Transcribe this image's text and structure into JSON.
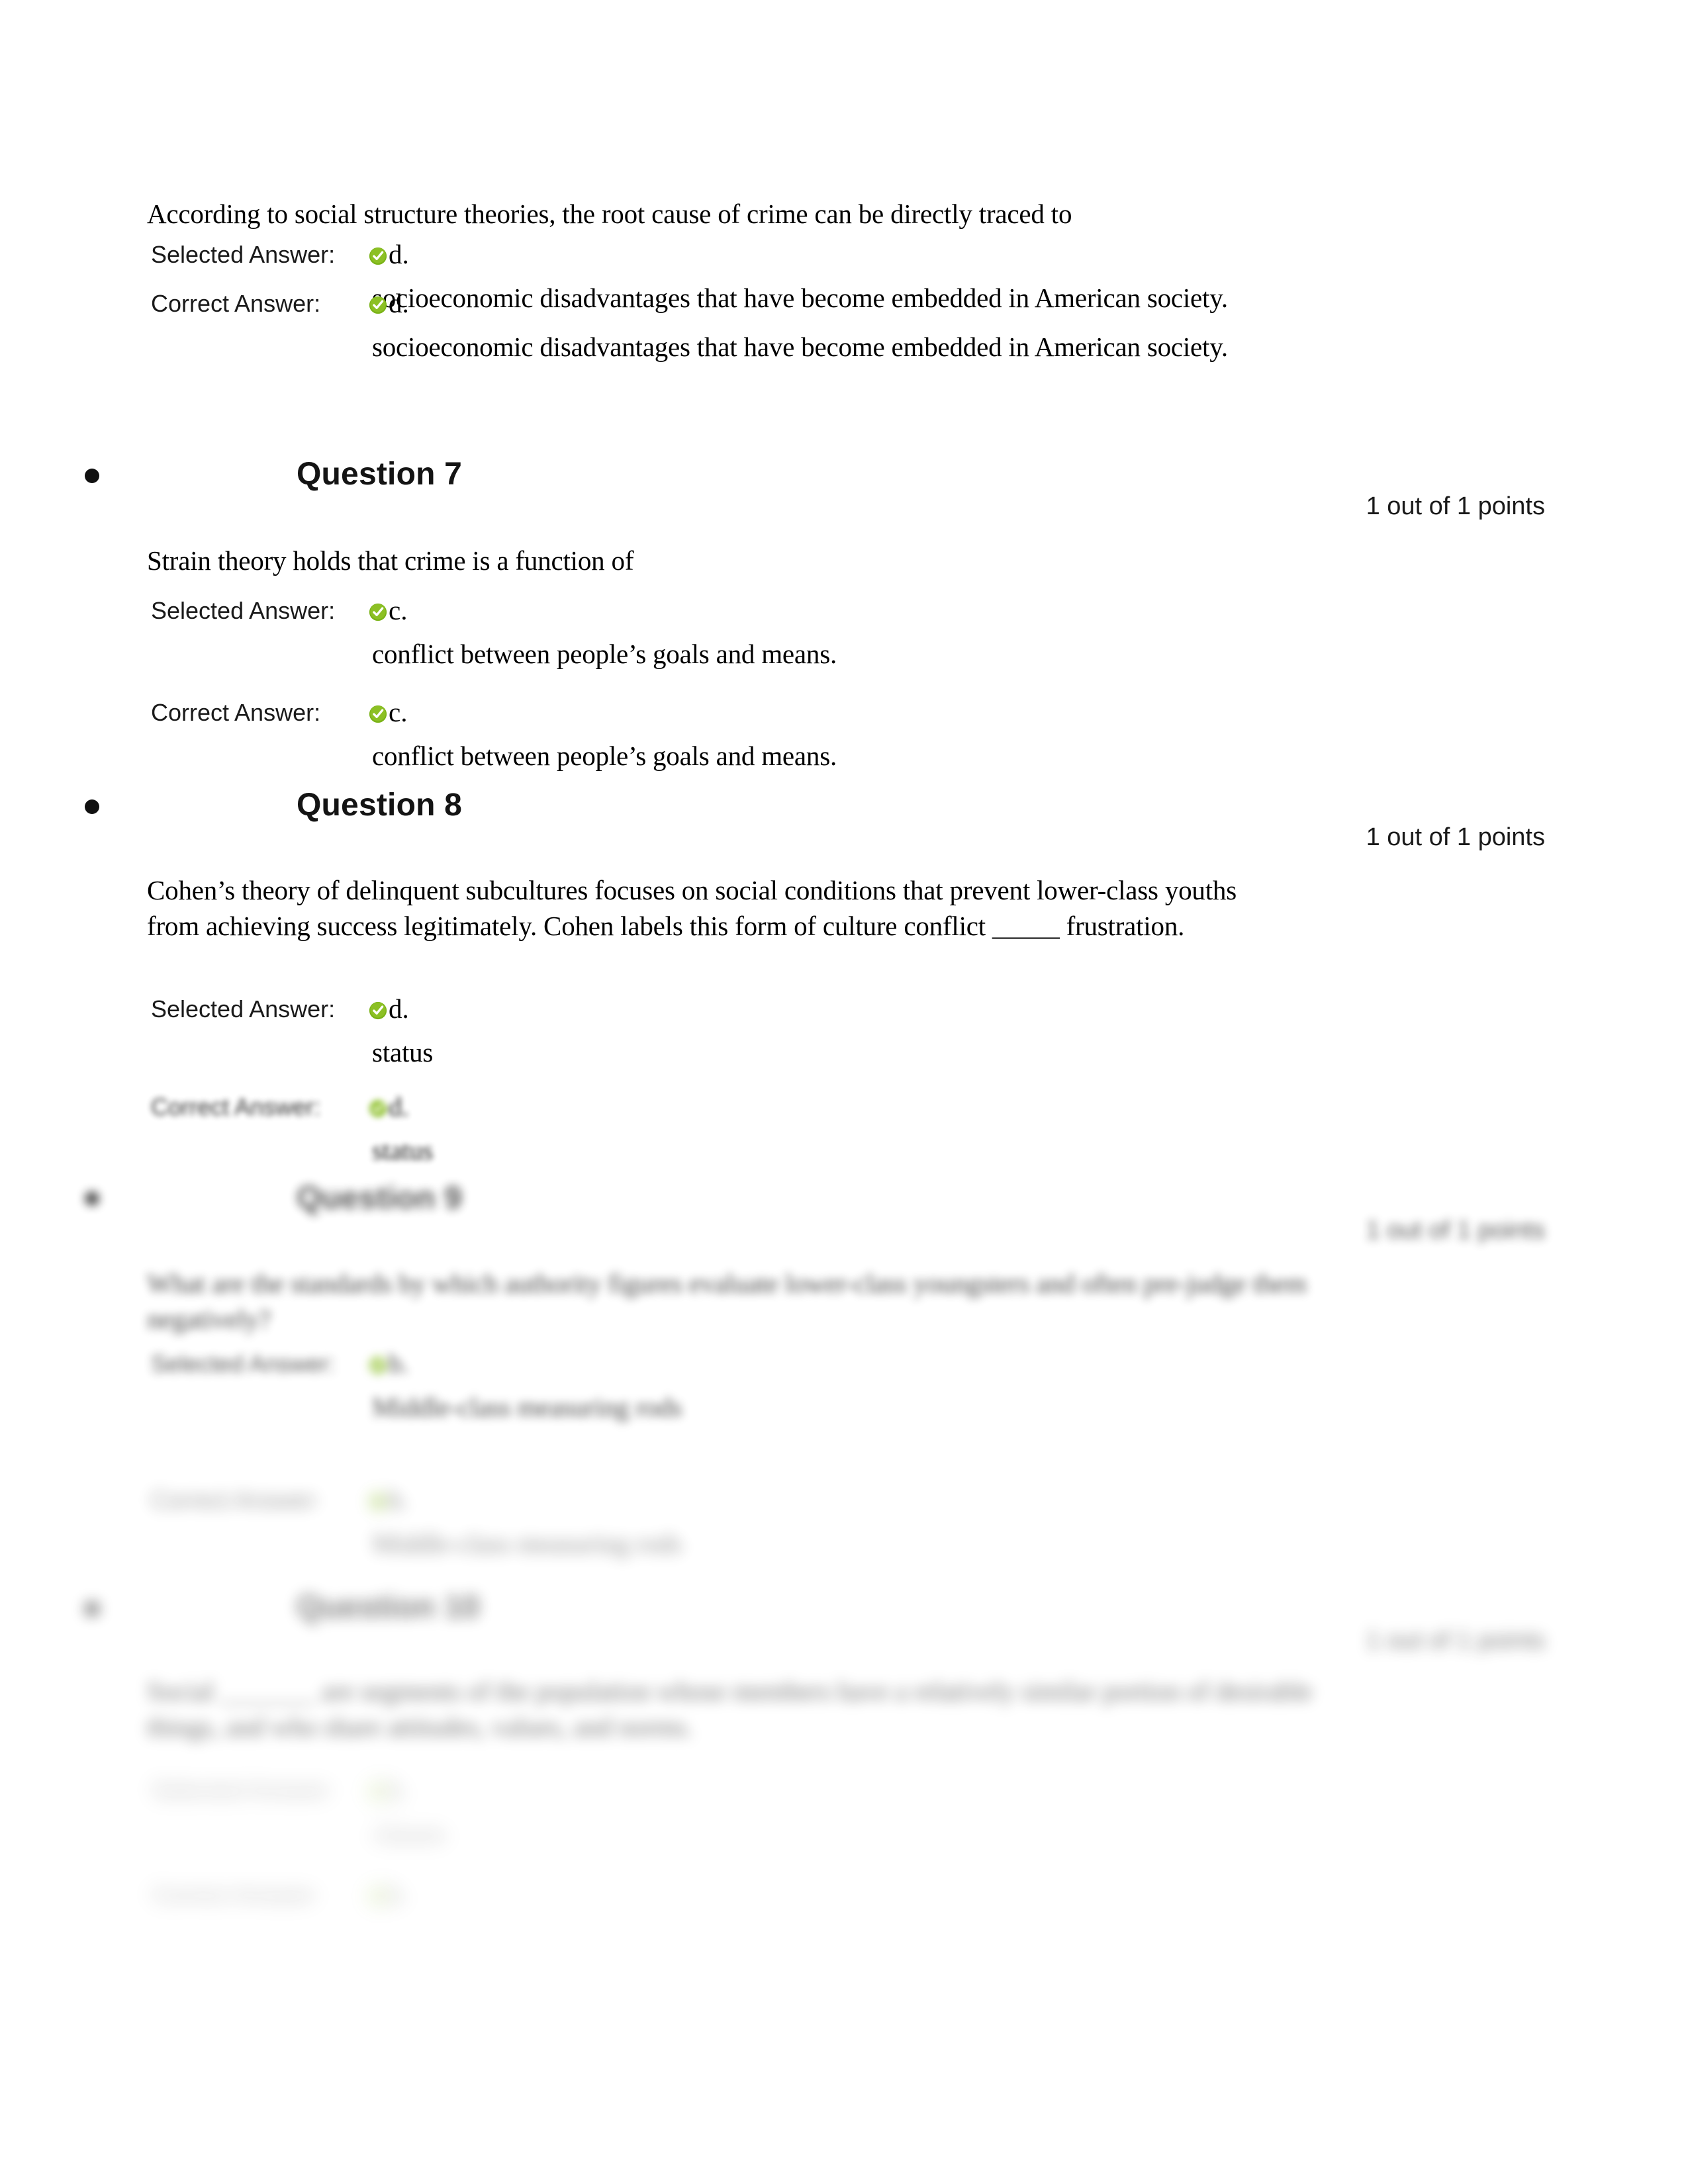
{
  "document": {
    "kind": "quiz-review",
    "accent_check_color": "#7AB317",
    "text_color": "#000000"
  },
  "labels": {
    "selected_answer": "Selected Answer:",
    "correct_answer": "Correct Answer:"
  },
  "questions": [
    {
      "id": "q6",
      "heading": null,
      "points": null,
      "stem": "According to social structure theories, the root cause of crime can be directly traced to",
      "selected": {
        "label": "Selected Answer:",
        "icon": "green-check-icon",
        "letter": "d.",
        "text": "socioeconomic disadvantages that have become embedded in American society."
      },
      "correct": {
        "label": "Correct Answer:",
        "icon": "green-check-icon",
        "letter": "d.",
        "text": "socioeconomic disadvantages that have become embedded in American society."
      }
    },
    {
      "id": "q7",
      "heading": "Question 7",
      "points": "1 out of 1 points",
      "stem": "Strain theory holds that crime is a function of",
      "selected": {
        "label": "Selected Answer:",
        "icon": "green-check-icon",
        "letter": "c.",
        "text": "conflict between people’s goals and means."
      },
      "correct": {
        "label": "Correct Answer:",
        "icon": "green-check-icon",
        "letter": "c.",
        "text": "conflict between people’s goals and means."
      }
    },
    {
      "id": "q8",
      "heading": "Question 8",
      "points": "1 out of 1 points",
      "stem": "Cohen’s theory of delinquent subcultures focuses on social conditions that prevent lower-class youths from achieving success legitimately. Cohen labels this form of culture conflict _____ frustration.",
      "selected": {
        "label": "Selected Answer:",
        "icon": "green-check-icon",
        "letter": "d.",
        "text": "status"
      },
      "correct": {
        "label": "Correct Answer:",
        "icon": "green-check-icon",
        "letter": "d.",
        "text": "status"
      }
    },
    {
      "id": "q9",
      "heading": "Question 9",
      "points": "1 out of 1 points",
      "stem": "What are the standards by which authority figures evaluate lower-class youngsters and often pre-judge them negatively?",
      "selected": {
        "label": "Selected Answer:",
        "icon": "green-check-icon",
        "letter": "b.",
        "text": "Middle-class measuring rods"
      },
      "correct": {
        "label": "Correct Answer:",
        "icon": "green-check-icon",
        "letter": "b.",
        "text": "Middle-class measuring rods"
      }
    },
    {
      "id": "q10",
      "heading": "Question 10",
      "points": "1 out of 1 points",
      "stem": "Social _______ are segments of the population whose members have a relatively similar portion of desirable things, and who share attitudes, values, and norms.",
      "selected": {
        "label": "Selected Answer:",
        "icon": "green-check-icon",
        "letter": "b.",
        "text": "classes"
      },
      "correct": {
        "label": "Correct Answer:",
        "icon": "green-check-icon",
        "letter": "b.",
        "text": ""
      }
    }
  ]
}
